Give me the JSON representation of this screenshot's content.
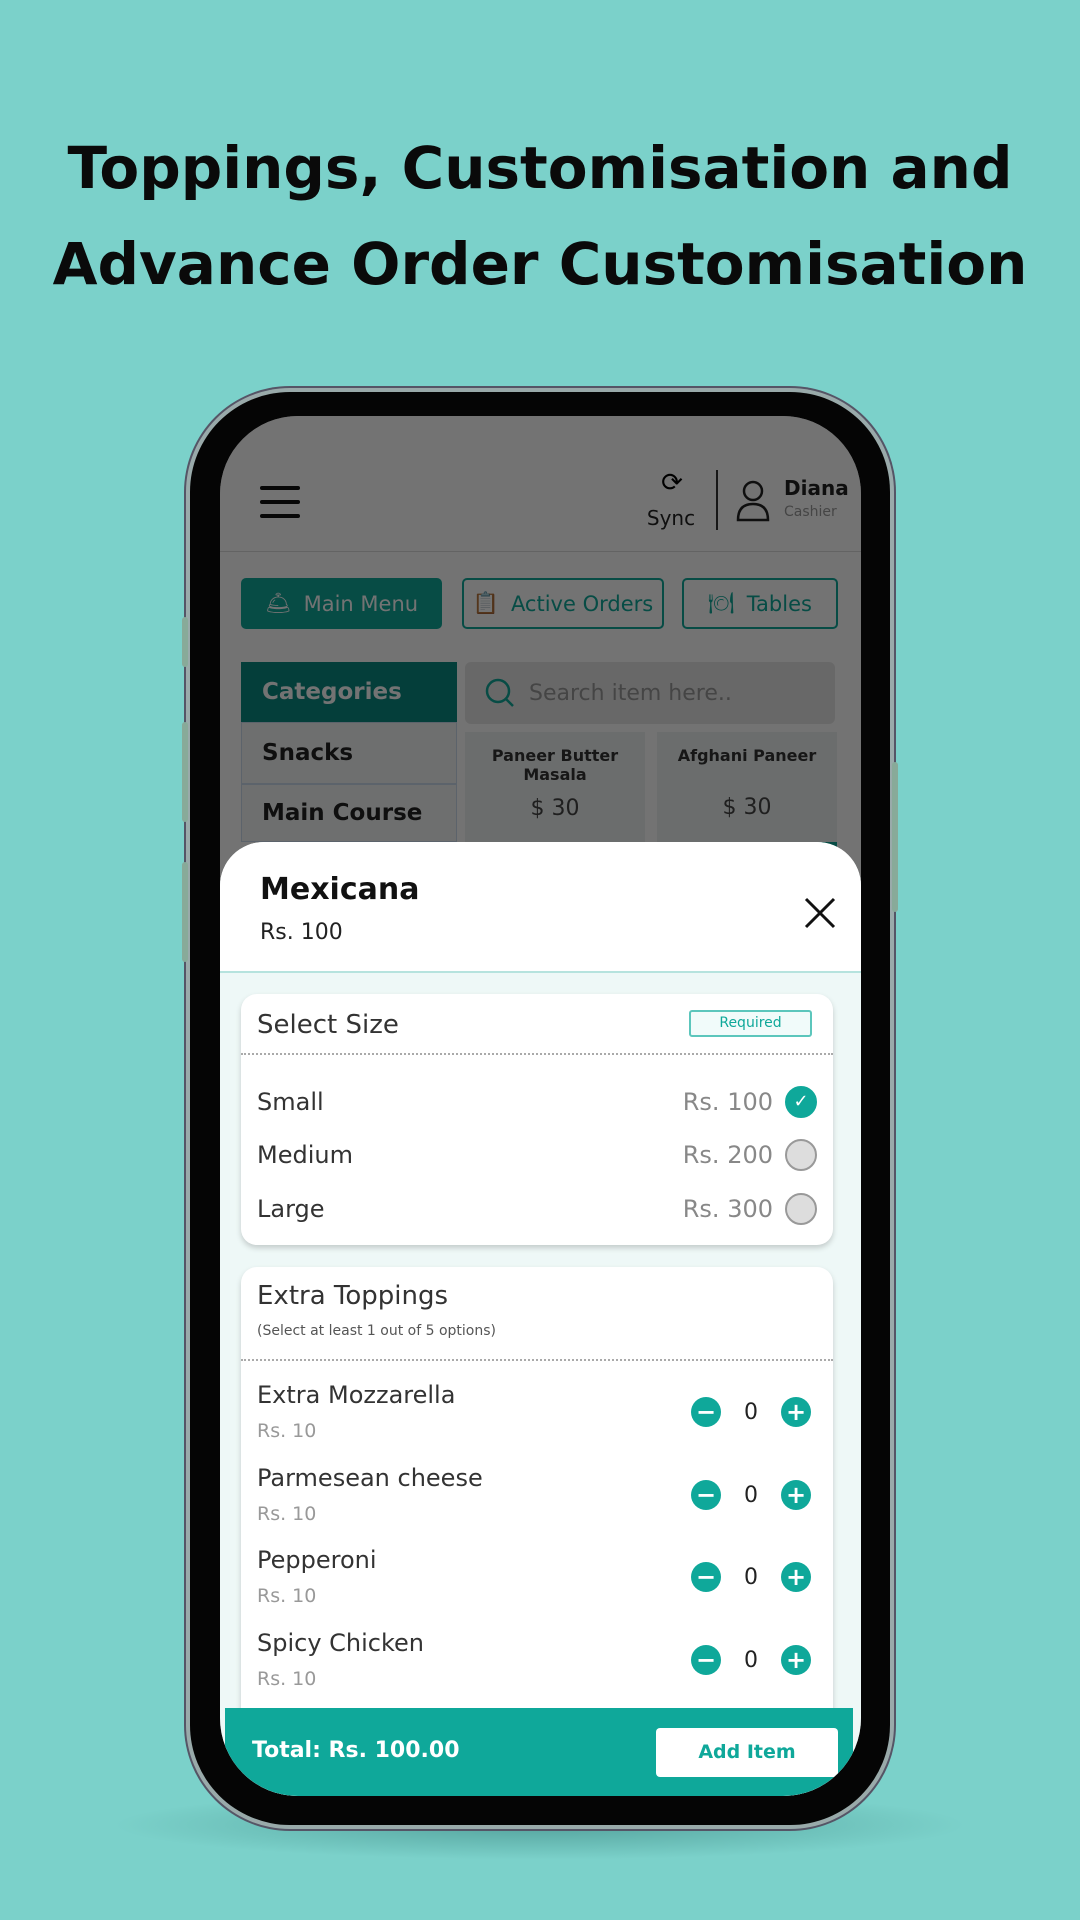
{
  "headline": {
    "line1": "Toppings, Customisation and",
    "line2": "Advance Order Customisation"
  },
  "colors": {
    "background": "#7bd1ca",
    "accent": "#0fa89a"
  },
  "app_header": {
    "sync_label": "Sync",
    "user_name": "Diana",
    "user_role": "Cashier"
  },
  "nav": {
    "main_menu": "Main Menu",
    "active_orders": "Active Orders",
    "tables": "Tables"
  },
  "categories": {
    "header": "Categories",
    "items": [
      "Snacks",
      "Main Course"
    ]
  },
  "search": {
    "placeholder": "Search item here.."
  },
  "menu_cards": [
    {
      "name": "Paneer Butter Masala",
      "price": "$ 30"
    },
    {
      "name": "Afghani Paneer",
      "price": "$ 30"
    }
  ],
  "modal": {
    "item_name": "Mexicana",
    "item_price": "Rs. 100",
    "size_section": {
      "title": "Select Size",
      "badge": "Required",
      "options": [
        {
          "label": "Small",
          "price": "Rs. 100",
          "selected": true
        },
        {
          "label": "Medium",
          "price": "Rs. 200",
          "selected": false
        },
        {
          "label": "Large",
          "price": "Rs. 300",
          "selected": false
        }
      ]
    },
    "toppings_section": {
      "title": "Extra Toppings",
      "subtitle": "(Select at least 1 out of 5 options)",
      "items": [
        {
          "name": "Extra Mozzarella",
          "price": "Rs. 10",
          "qty": "0"
        },
        {
          "name": "Parmesean cheese",
          "price": "Rs. 10",
          "qty": "0"
        },
        {
          "name": "Pepperoni",
          "price": "Rs. 10",
          "qty": "0"
        },
        {
          "name": "Spicy Chicken",
          "price": "Rs. 10",
          "qty": "0"
        }
      ]
    },
    "footer": {
      "total": "Total: Rs. 100.00",
      "add_button": "Add Item"
    }
  }
}
